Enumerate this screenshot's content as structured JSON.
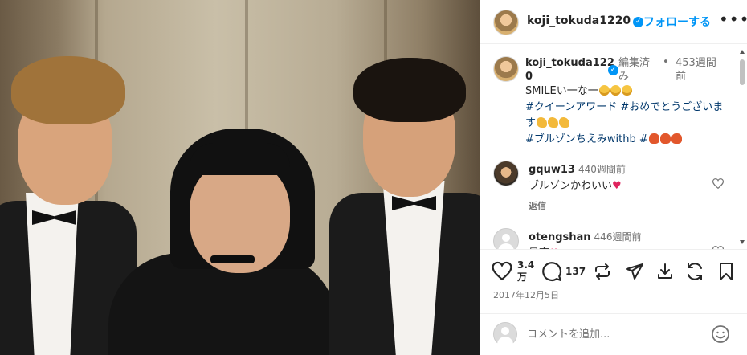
{
  "post": {
    "username": "koji_tokuda1220",
    "follow_label": "フォローする",
    "more_label": "•••"
  },
  "caption": {
    "username_line1": "koji_tokuda122",
    "username_line2": "0",
    "edited": "編集済み",
    "dot": "•",
    "time": "453週間前",
    "text_start": "SMILEい一な一",
    "hashtag1": "#クイーンアワード",
    "hashtag2": "#おめでとうございます",
    "hashtag3": "#ブルゾンちえみwithb",
    "hashtag4": "#"
  },
  "comments": [
    {
      "username": "gquw13",
      "time": "440週間前",
      "text": "ブルゾンかわいい",
      "reply": "返信"
    },
    {
      "username": "otengshan",
      "time": "446週間前",
      "text": "最高"
    }
  ],
  "stats": {
    "likes_line1": "3.4",
    "likes_line2": "万",
    "comments": "137",
    "date": "2017年12月5日"
  },
  "add_comment": {
    "placeholder": "コメントを追加..."
  },
  "colors": {
    "accent": "#0095f6",
    "hashtag": "#00376b",
    "secondary_text": "#737373"
  }
}
